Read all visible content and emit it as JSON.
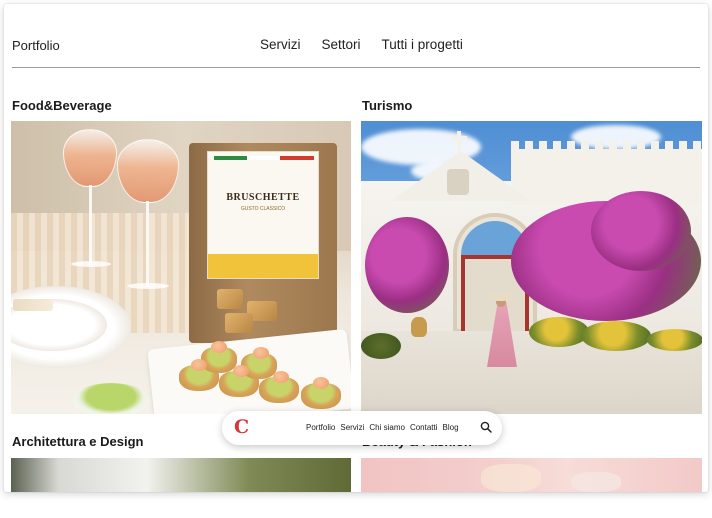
{
  "header": {
    "brand": "Portfolio",
    "nav": [
      "Servizi",
      "Settori",
      "Tutti i progetti"
    ]
  },
  "sections": [
    {
      "title": "Food&Beverage"
    },
    {
      "title": "Turismo"
    },
    {
      "title": "Architettura e Design"
    },
    {
      "title": "Beauty & Fashion"
    }
  ],
  "product_label": {
    "name": "BRUSCHETTE",
    "subtitle": "GUSTO CLASSICO"
  },
  "floating_menu": {
    "logo": "C",
    "items": [
      "Portfolio",
      "Servizi",
      "Chi siamo",
      "Contatti",
      "Blog"
    ],
    "search_icon": "search-icon"
  },
  "colors": {
    "logo_red": "#d6383a",
    "divider": "#9a9a9a"
  }
}
